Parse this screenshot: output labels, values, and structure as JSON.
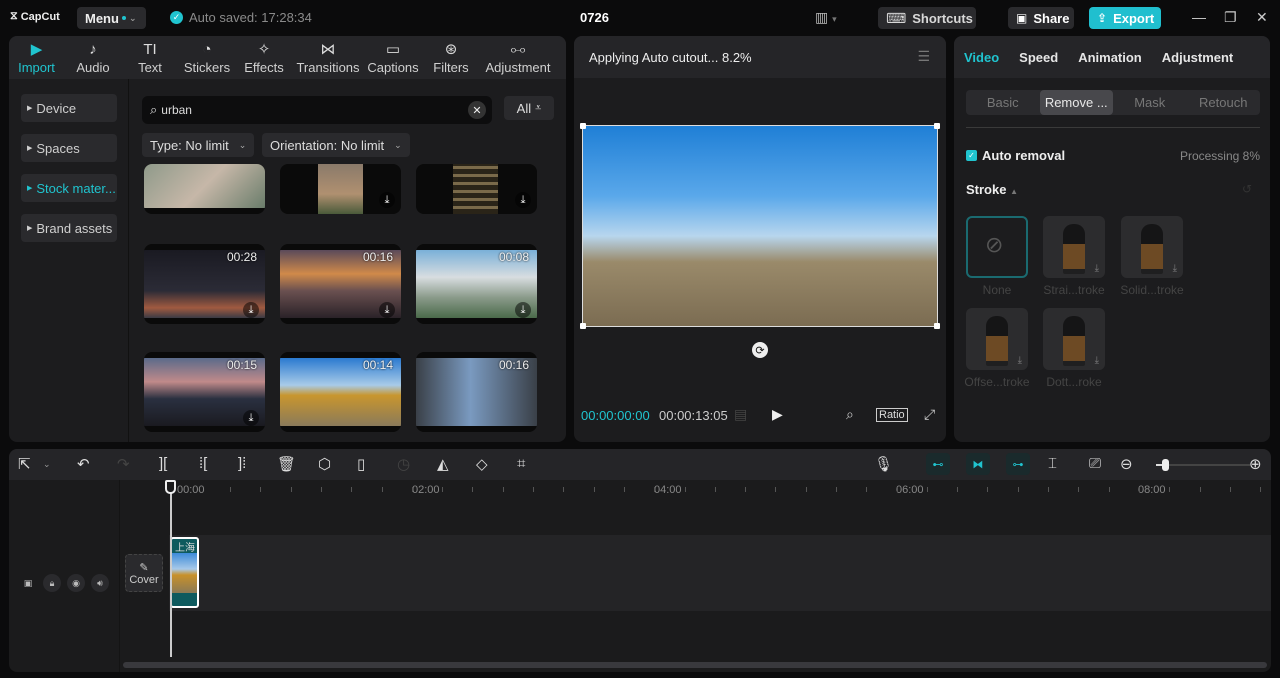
{
  "titlebar": {
    "app_name": "CapCut",
    "menu_label": "Menu",
    "autosave_text": "Auto saved: 17:28:34",
    "project_title": "0726",
    "shortcuts_label": "Shortcuts",
    "share_label": "Share",
    "export_label": "Export"
  },
  "media_tabs": [
    {
      "label": "Import",
      "icon": "import-icon",
      "glyph": "▶",
      "active": true
    },
    {
      "label": "Audio",
      "icon": "audio-icon",
      "glyph": "♪"
    },
    {
      "label": "Text",
      "icon": "text-icon",
      "glyph": "TI"
    },
    {
      "label": "Stickers",
      "icon": "sticker-icon",
      "glyph": "◔"
    },
    {
      "label": "Effects",
      "icon": "effects-icon",
      "glyph": "✧"
    },
    {
      "label": "Transitions",
      "icon": "transitions-icon",
      "glyph": "⋈"
    },
    {
      "label": "Captions",
      "icon": "captions-icon",
      "glyph": "▭"
    },
    {
      "label": "Filters",
      "icon": "filters-icon",
      "glyph": "⊛"
    },
    {
      "label": "Adjustment",
      "icon": "adjustment-icon",
      "glyph": "⧟"
    }
  ],
  "media_sidebar": [
    {
      "label": "Device"
    },
    {
      "label": "Spaces"
    },
    {
      "label": "Stock mater...",
      "active": true
    },
    {
      "label": "Brand assets"
    }
  ],
  "search": {
    "value": "urban",
    "all_label": "All"
  },
  "filters": {
    "type": "Type: No limit",
    "orientation": "Orientation: No limit"
  },
  "thumbnails": [
    {
      "duration": "",
      "download": false
    },
    {
      "duration": "",
      "download": true
    },
    {
      "duration": "",
      "download": true
    },
    {
      "duration": "00:28",
      "download": true
    },
    {
      "duration": "00:16",
      "download": true
    },
    {
      "duration": "00:08",
      "download": true
    },
    {
      "duration": "00:15",
      "download": true
    },
    {
      "duration": "00:14",
      "download": false
    },
    {
      "duration": "00:16",
      "download": false
    }
  ],
  "player": {
    "status": "Applying Auto cutout... 8.2%",
    "current_time": "00:00:00:00",
    "total_time": "00:00:13:05",
    "ratio_label": "Ratio"
  },
  "inspector": {
    "tabs": [
      {
        "label": "Video",
        "active": true
      },
      {
        "label": "Speed"
      },
      {
        "label": "Animation"
      },
      {
        "label": "Adjustment"
      }
    ],
    "subtabs": [
      {
        "label": "Basic"
      },
      {
        "label": "Remove ...",
        "active": true
      },
      {
        "label": "Mask"
      },
      {
        "label": "Retouch"
      }
    ],
    "auto_removal_label": "Auto removal",
    "auto_removal_checked": true,
    "processing": "Processing 8%",
    "stroke_label": "Stroke",
    "stroke_options": [
      {
        "label": "None",
        "selected": true
      },
      {
        "label": "Strai...troke"
      },
      {
        "label": "Solid...troke"
      },
      {
        "label": "Offse...troke"
      },
      {
        "label": "Dott...roke"
      }
    ]
  },
  "timeline": {
    "ruler": [
      "00:00",
      "02:00",
      "04:00",
      "06:00",
      "08:00"
    ],
    "cover_label": "Cover",
    "clip_text": "上海",
    "zoom_level": 0.1
  },
  "colors": {
    "accent": "#20c4cf"
  }
}
